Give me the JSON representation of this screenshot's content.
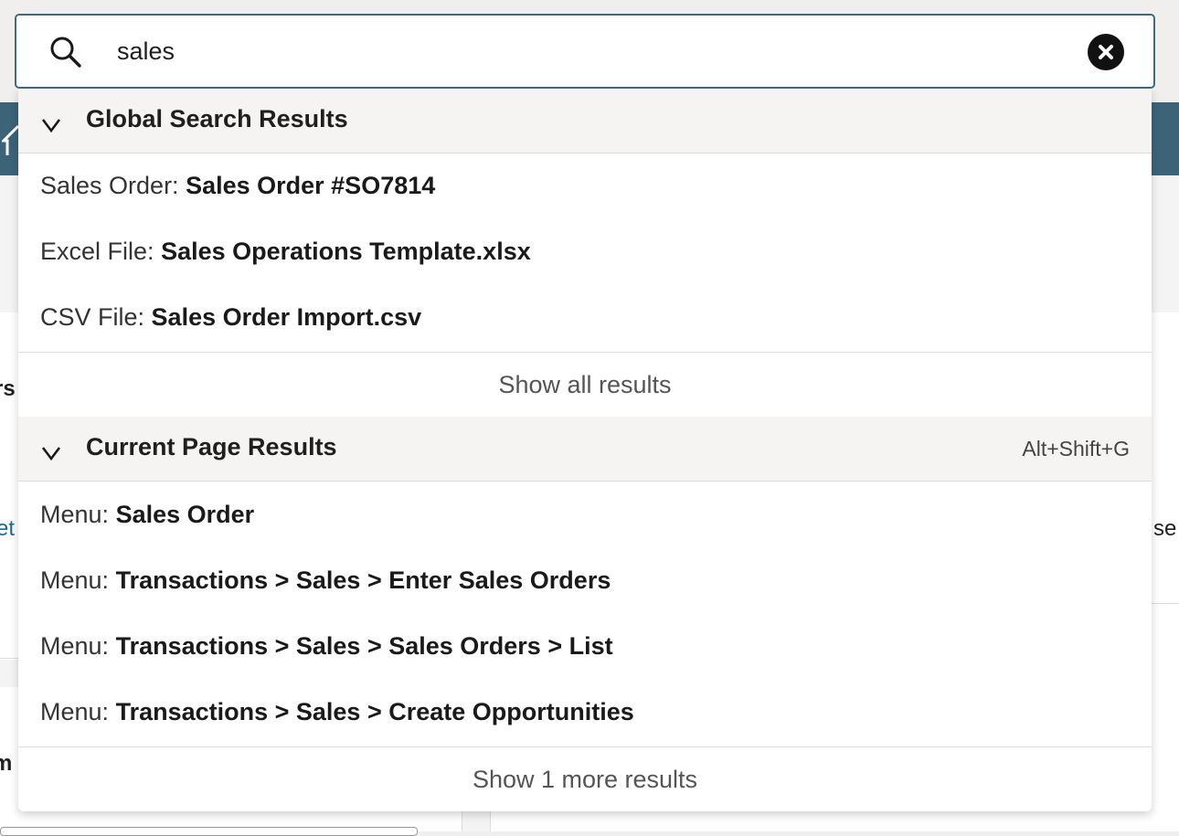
{
  "search": {
    "value": "sales",
    "placeholder": ""
  },
  "background": {
    "fragments": [
      "rs",
      "et",
      "se",
      "m"
    ]
  },
  "global_section": {
    "title": "Global Search Results",
    "items": [
      {
        "type": "Sales Order:",
        "name": "Sales Order #SO7814"
      },
      {
        "type": "Excel File:",
        "name": "Sales Operations Template.xlsx"
      },
      {
        "type": "CSV File:",
        "name": "Sales Order Import.csv"
      }
    ],
    "show_all_label": "Show all results"
  },
  "page_section": {
    "title": "Current Page Results",
    "shortcut": "Alt+Shift+G",
    "items": [
      {
        "type": "Menu:",
        "name": "Sales Order"
      },
      {
        "type": "Menu:",
        "name": "Transactions > Sales > Enter Sales Orders"
      },
      {
        "type": "Menu:",
        "name": "Transactions > Sales > Sales Orders > List"
      },
      {
        "type": "Menu:",
        "name": "Transactions > Sales > Create Opportunities"
      }
    ],
    "show_more_label": "Show 1 more results"
  },
  "colors": {
    "nav_bar": "#3d6378",
    "search_border": "#3d6b80",
    "link": "#1d6b91"
  },
  "icons": {
    "search": "search-icon",
    "clear": "close-icon",
    "section_toggle": "chevron-down-icon",
    "home": "home-icon"
  }
}
